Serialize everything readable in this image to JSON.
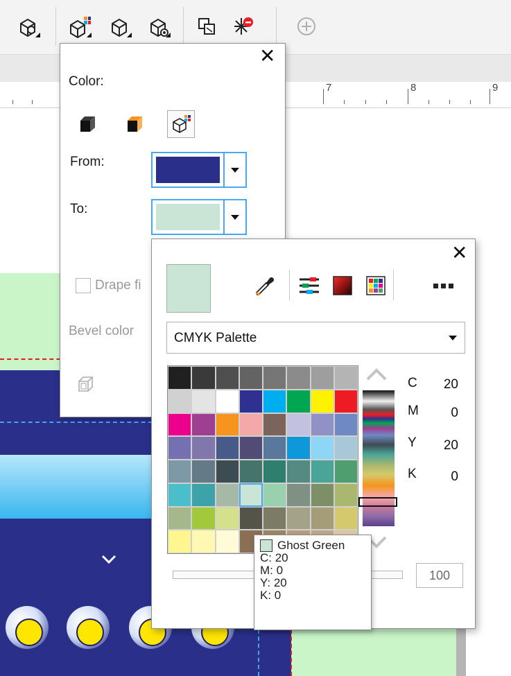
{
  "ruler": {
    "marks": [
      "7",
      "8",
      "9"
    ]
  },
  "color_panel": {
    "title": "Color:",
    "from_label": "From:",
    "to_label": "To:",
    "from_color": "#2a2f8a",
    "to_color": "#cae5d6",
    "drape_label": "Drape fi",
    "bevel_label": "Bevel color"
  },
  "palette_popup": {
    "current_color": "#cae5d6",
    "palette_name": "CMYK Palette",
    "selected_index": 43,
    "swatches": [
      "#202020",
      "#3a3a3a",
      "#4f4f4f",
      "#636363",
      "#767676",
      "#8b8b8b",
      "#9e9e9e",
      "#b4b4b4",
      "#d1d1d1",
      "#e4e4e4",
      "#ffffff",
      "#2e3191",
      "#00aeef",
      "#00a651",
      "#fff200",
      "#ed1c24",
      "#ec008c",
      "#9e3f91",
      "#f7941d",
      "#f5a8a8",
      "#7b645c",
      "#c3c1e0",
      "#9091c4",
      "#6f89c4",
      "#7470b2",
      "#8277ac",
      "#485a8a",
      "#504c76",
      "#5a789b",
      "#0e98d9",
      "#8dd6f5",
      "#a8c8d8",
      "#7e99a6",
      "#647a86",
      "#3d4b53",
      "#44746c",
      "#2f7f6e",
      "#548a82",
      "#4aa497",
      "#4e9e70",
      "#4bbecc",
      "#3ea3a9",
      "#a6b9a7",
      "#cae5d6",
      "#99d1af",
      "#7e9184",
      "#7d8f66",
      "#a9b76f",
      "#a5b88c",
      "#a1c93a",
      "#d4e08c",
      "#555449",
      "#7b7b66",
      "#a4a38a",
      "#a59d78",
      "#d5c96d",
      "#fff68f",
      "#fff8b2",
      "#fffbd9",
      "#8a6e55",
      "#9b8565",
      "#b79e7c",
      "#bda98a",
      "#d9c8a2"
    ],
    "cmyk": [
      {
        "label": "C",
        "value": "20"
      },
      {
        "label": "M",
        "value": "0"
      },
      {
        "label": "Y",
        "value": "20"
      },
      {
        "label": "K",
        "value": "0"
      }
    ],
    "opacity": "100"
  },
  "tooltip": {
    "name": "Ghost Green",
    "c": "C: 20",
    "m": "M: 0",
    "y": "Y: 20",
    "k": "K: 0"
  }
}
